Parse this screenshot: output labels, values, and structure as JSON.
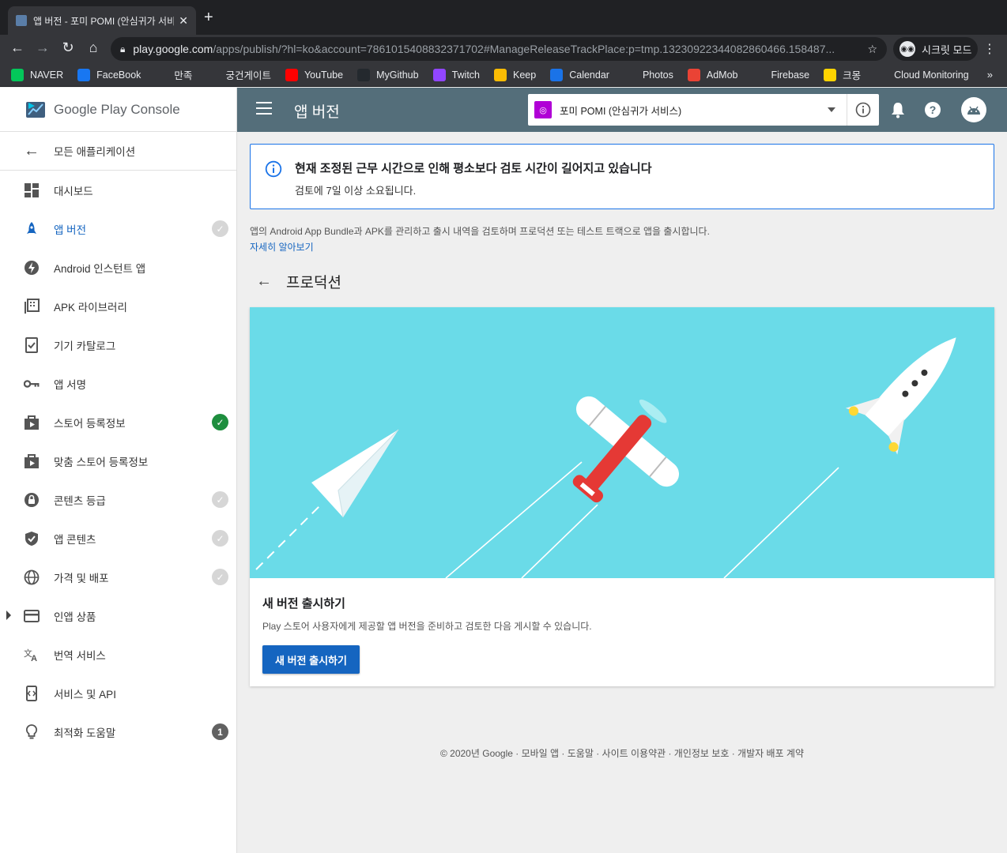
{
  "browser": {
    "tab_title": "앱 버전 - 포미 POMI (안심귀가 서비스)",
    "url_host": "play.google.com",
    "url_path": "/apps/publish/?hl=ko&account=7861015408832371702#ManageReleaseTrackPlace:p=tmp.13230922344082860466.158487...",
    "incognito_label": "시크릿 모드",
    "bookmarks": [
      {
        "label": "NAVER",
        "icon": "naver-icon",
        "color": "#03c75a"
      },
      {
        "label": "FaceBook",
        "icon": "facebook-icon",
        "color": "#1877f2"
      },
      {
        "label": "만족",
        "icon": "dots-icon",
        "color": "#35363a"
      },
      {
        "label": "궁건게이트",
        "icon": "globe-icon",
        "color": "#35363a"
      },
      {
        "label": "YouTube",
        "icon": "youtube-icon",
        "color": "#ff0000"
      },
      {
        "label": "MyGithub",
        "icon": "github-icon",
        "color": "#24292e"
      },
      {
        "label": "Twitch",
        "icon": "twitch-icon",
        "color": "#9146ff"
      },
      {
        "label": "Keep",
        "icon": "keep-icon",
        "color": "#fbbc04"
      },
      {
        "label": "Calendar",
        "icon": "calendar-icon",
        "color": "#1a73e8"
      },
      {
        "label": "Photos",
        "icon": "photos-icon",
        "color": "#35363a"
      },
      {
        "label": "AdMob",
        "icon": "admob-icon",
        "color": "#ea4335"
      },
      {
        "label": "Firebase",
        "icon": "firebase-icon",
        "color": "#35363a"
      },
      {
        "label": "크몽",
        "icon": "kmong-icon",
        "color": "#ffd400"
      },
      {
        "label": "Cloud Monitoring",
        "icon": "monitoring-icon",
        "color": "#35363a"
      }
    ]
  },
  "sidebar": {
    "logo_text": "Google Play Console",
    "back_label": "모든 애플리케이션",
    "items": [
      {
        "label": "대시보드",
        "icon": "dashboard-icon",
        "status": ""
      },
      {
        "label": "앱 버전",
        "icon": "rocket-icon",
        "status": "gray",
        "active": true
      },
      {
        "label": "Android 인스턴트 앱",
        "icon": "instant-icon",
        "status": ""
      },
      {
        "label": "APK 라이브러리",
        "icon": "library-icon",
        "status": ""
      },
      {
        "label": "기기 카탈로그",
        "icon": "device-icon",
        "status": ""
      },
      {
        "label": "앱 서명",
        "icon": "key-icon",
        "status": ""
      },
      {
        "label": "스토어 등록정보",
        "icon": "store-icon",
        "status": "green"
      },
      {
        "label": "맞춤 스토어 등록정보",
        "icon": "store-icon",
        "status": ""
      },
      {
        "label": "콘텐츠 등급",
        "icon": "rating-icon",
        "status": "gray"
      },
      {
        "label": "앱 콘텐츠",
        "icon": "shield-icon",
        "status": "gray"
      },
      {
        "label": "가격 및 배포",
        "icon": "globe-icon",
        "status": "gray"
      },
      {
        "label": "인앱 상품",
        "icon": "card-icon",
        "status": "",
        "expandable": true
      },
      {
        "label": "번역 서비스",
        "icon": "translate-icon",
        "status": ""
      },
      {
        "label": "서비스 및 API",
        "icon": "api-icon",
        "status": ""
      },
      {
        "label": "최적화 도움말",
        "icon": "bulb-icon",
        "status": "num",
        "count": "1"
      }
    ]
  },
  "header": {
    "title": "앱 버전",
    "app_name": "포미 POMI (안심귀가 서비스)"
  },
  "notice": {
    "title": "현재 조정된 근무 시간으로 인해 평소보다 검토 시간이 길어지고 있습니다",
    "subtitle": "검토에 7일 이상 소요됩니다."
  },
  "main": {
    "description": "앱의 Android App Bundle과 APK를 관리하고 출시 내역을 검토하며 프로덕션 또는 테스트 트랙으로 앱을 출시합니다.",
    "learn_more": "자세히 알아보기",
    "section_title": "프로덕션",
    "card_title": "새 버전 출시하기",
    "card_text": "Play 스토어 사용자에게 제공할 앱 버전을 준비하고 검토한 다음 게시할 수 있습니다.",
    "card_button": "새 버전 출시하기"
  },
  "footer": "© 2020년 Google · 모바일 앱 · 도움말 · 사이트 이용약관 · 개인정보 보호 · 개발자 배포 계약",
  "colors": {
    "accent": "#1565c0",
    "header": "#546e7a",
    "hero": "#6adbe8"
  }
}
